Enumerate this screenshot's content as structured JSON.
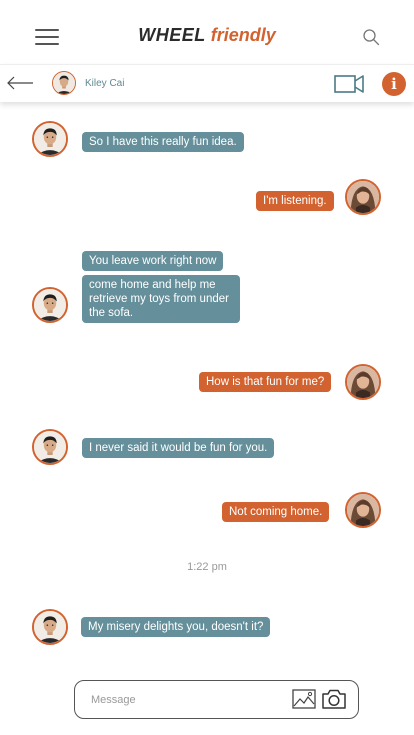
{
  "app": {
    "brand_part1": "WHEEL",
    "brand_part2": "friendly",
    "accent_color": "#d2622f",
    "incoming_color": "#658f9a"
  },
  "header": {
    "menu_icon": "hamburger-menu-icon",
    "search_icon": "search-icon"
  },
  "conversation": {
    "contact_name": "Kiley Cai",
    "back_icon": "back-arrow-icon",
    "video_icon": "video-call-icon",
    "info_label": "i"
  },
  "messages": [
    {
      "side": "in",
      "text": "So I have this really fun idea."
    },
    {
      "side": "out",
      "text": "I'm listening."
    },
    {
      "side": "in",
      "text": "You leave work right now"
    },
    {
      "side": "in",
      "text": "come home and help me retrieve my toys from under the sofa."
    },
    {
      "side": "out",
      "text": "How is that fun for me?"
    },
    {
      "side": "in",
      "text": "I never said it would be fun for you."
    },
    {
      "side": "out",
      "text": "Not coming home."
    },
    {
      "side": "in",
      "text": "My misery delights you, doesn't it?"
    }
  ],
  "timestamp": "1:22 pm",
  "composer": {
    "placeholder": "Message",
    "value": "",
    "image_icon": "image-attach-icon",
    "camera_icon": "camera-icon"
  }
}
